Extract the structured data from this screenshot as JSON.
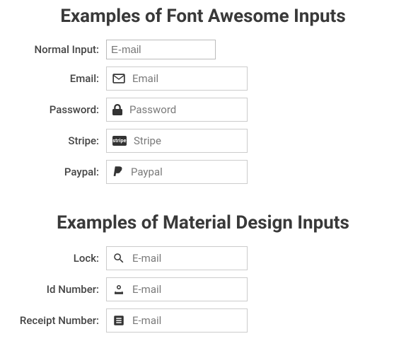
{
  "section1": {
    "title": "Examples of Font Awesome Inputs",
    "rows": {
      "normal": {
        "label": "Normal Input:",
        "placeholder": "E-mail"
      },
      "email": {
        "label": "Email:",
        "placeholder": "Email"
      },
      "password": {
        "label": "Password:",
        "placeholder": "Password"
      },
      "stripe": {
        "label": "Stripe:",
        "placeholder": "Stripe",
        "badge": "stripe"
      },
      "paypal": {
        "label": "Paypal:",
        "placeholder": "Paypal"
      }
    }
  },
  "section2": {
    "title": "Examples of Material Design Inputs",
    "rows": {
      "lock": {
        "label": "Lock:",
        "placeholder": "E-mail"
      },
      "id": {
        "label": "Id Number:",
        "placeholder": "E-mail"
      },
      "receipt": {
        "label": "Receipt Number:",
        "placeholder": "E-mail"
      }
    }
  }
}
